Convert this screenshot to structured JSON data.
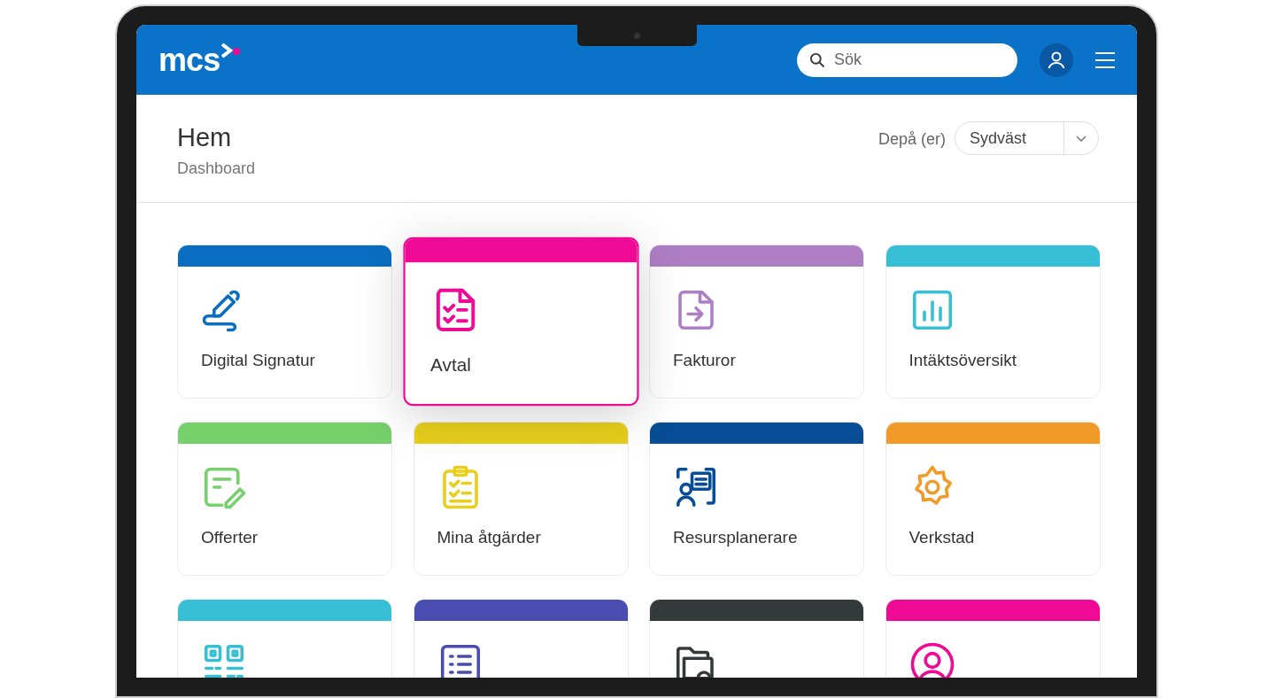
{
  "header": {
    "logo": "mcs",
    "search": {
      "placeholder": "Sök"
    }
  },
  "page": {
    "title": "Hem",
    "subtitle": "Dashboard",
    "depot_label": "Depå (er)",
    "depot_value": "Sydväst"
  },
  "tiles": [
    {
      "label": "Digital Signatur",
      "color": "#0a6fc2",
      "selected": false
    },
    {
      "label": "Avtal",
      "color": "#ee0a95",
      "selected": true
    },
    {
      "label": "Fakturor",
      "color": "#ae7fc4",
      "selected": false
    },
    {
      "label": "Intäktsöversikt",
      "color": "#37bfd6",
      "selected": false
    },
    {
      "label": "Offerter",
      "color": "#76d06c",
      "selected": false
    },
    {
      "label": "Mina åtgärder",
      "color": "#e8cf1c",
      "selected": false
    },
    {
      "label": "Resursplanerare",
      "color": "#084e96",
      "selected": false
    },
    {
      "label": "Verkstad",
      "color": "#f29a27",
      "selected": false
    },
    {
      "color": "#37bfd6",
      "selected": false
    },
    {
      "color": "#4a4db0",
      "selected": false
    },
    {
      "color": "#343a3a",
      "selected": false
    },
    {
      "color": "#ee0a95",
      "selected": false
    }
  ]
}
